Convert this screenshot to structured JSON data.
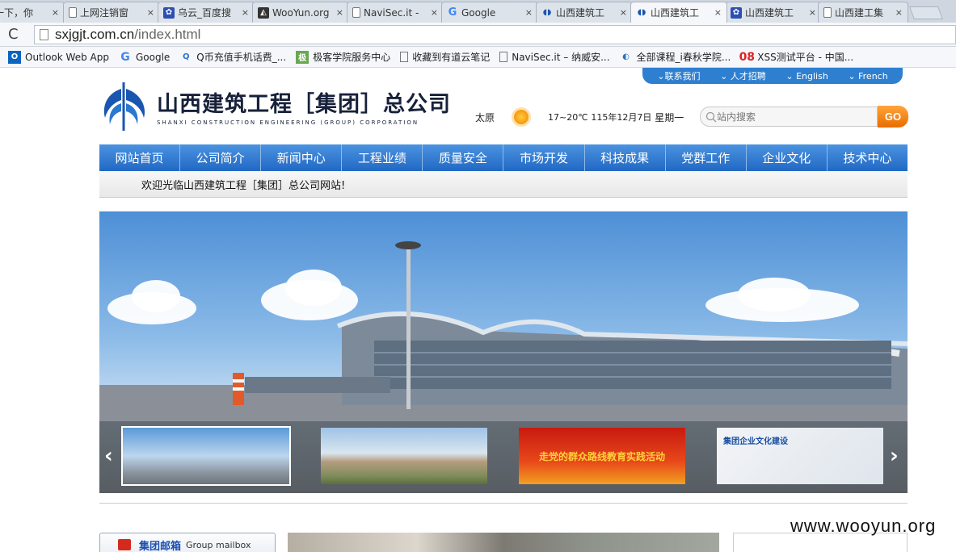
{
  "browser": {
    "tabs": [
      {
        "title": "度一下，你",
        "icon": "doc-icon",
        "active": false
      },
      {
        "title": "上网注销窗",
        "icon": "doc-icon",
        "active": false
      },
      {
        "title": "乌云_百度搜",
        "icon": "baidu-paw-icon",
        "active": false
      },
      {
        "title": "WooYun.org",
        "icon": "wooyun-icon",
        "active": false
      },
      {
        "title": "NaviSec.it -",
        "icon": "doc-icon",
        "active": false
      },
      {
        "title": "Google",
        "icon": "google-icon",
        "active": false
      },
      {
        "title": "山西建筑工",
        "icon": "sxjg-logo-icon",
        "active": false
      },
      {
        "title": "山西建筑工",
        "icon": "sxjg-logo-icon",
        "active": true
      },
      {
        "title": "山西建筑工",
        "icon": "baidu-paw-icon",
        "active": false
      },
      {
        "title": "山西建工集",
        "icon": "doc-icon",
        "active": false
      }
    ],
    "close_glyph": "×",
    "reload_glyph": "C",
    "url_host": "sxjgjt.com.cn",
    "url_path": "/index.html",
    "bookmarks": [
      {
        "label": "Outlook Web App",
        "icon": "outlook-icon",
        "glyph": "O"
      },
      {
        "label": "Google",
        "icon": "google-icon",
        "glyph": "G"
      },
      {
        "label": "Q币充值手机话费_...",
        "icon": "qq-icon",
        "glyph": "Q"
      },
      {
        "label": "极客学院服务中心",
        "icon": "jikexueyuan-icon",
        "glyph": "极"
      },
      {
        "label": "收藏到有道云笔记",
        "icon": "doc-icon",
        "glyph": ""
      },
      {
        "label": "NaviSec.it – 纳威安...",
        "icon": "doc-icon",
        "glyph": ""
      },
      {
        "label": "全部课程_i春秋学院...",
        "icon": "ichunqiu-icon",
        "glyph": "◐"
      },
      {
        "label": "XSS测试平台 - 中国...",
        "icon": "xss-08-icon",
        "glyph": "08"
      }
    ]
  },
  "site": {
    "top_links": [
      "联系我们",
      "人才招聘",
      "English",
      "French"
    ],
    "top_link_glyph": "⌄",
    "logo": {
      "cn": "山西建筑工程［集团］总公司",
      "en": "SHANXI CONSTRUCTION ENGINEERING (GROUP) CORPORATION"
    },
    "weather": {
      "city": "太原",
      "temp": "17~20℃",
      "date": "115年12月7日",
      "weekday": "星期一"
    },
    "search": {
      "placeholder": "站内搜索",
      "button": "GO"
    },
    "nav": [
      "网站首页",
      "公司简介",
      "新闻中心",
      "工程业绩",
      "质量安全",
      "市场开发",
      "科技成果",
      "党群工作",
      "企业文化",
      "技术中心"
    ],
    "welcome": "欢迎光临山西建筑工程［集团］总公司网站!",
    "slider": {
      "prev": "‹",
      "next": "›",
      "thumb3_text": "走党的群众路线教育实践活动",
      "thumb4_text": "集团企业文化建设"
    },
    "mailbox": {
      "title": "集团邮箱",
      "subtitle": "Group mailbox"
    }
  },
  "watermark": "www.wooyun.org"
}
